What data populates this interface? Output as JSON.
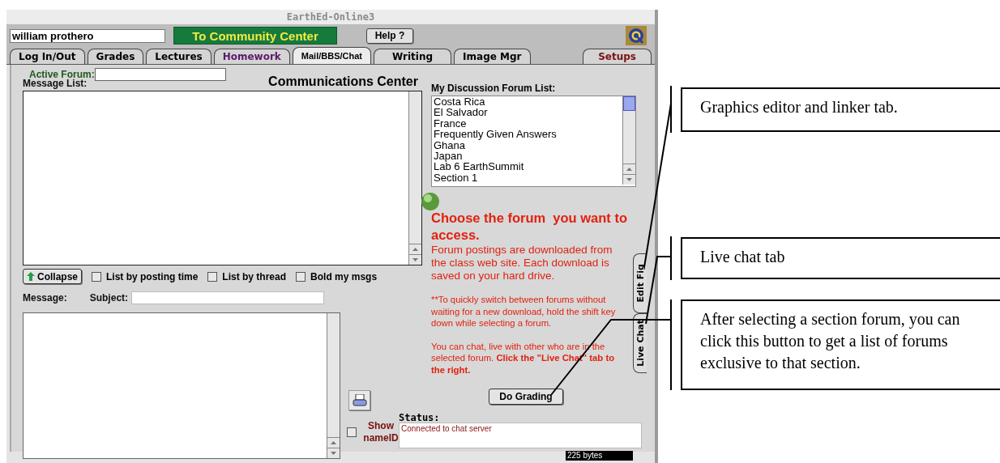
{
  "window": {
    "title": "EarthEd-Online3"
  },
  "user_field": {
    "value": "william prothero"
  },
  "community_button": "To Community Center",
  "help_button": "Help ?",
  "tabs": [
    {
      "label": "Log In/Out",
      "selected": false,
      "color": "#000000"
    },
    {
      "label": "Grades",
      "selected": false,
      "color": "#000000"
    },
    {
      "label": "Lectures",
      "selected": false,
      "color": "#000000"
    },
    {
      "label": "Homework",
      "selected": false,
      "color": "#5a1a6a"
    },
    {
      "label": "Mail/BBS/Chat",
      "selected": true,
      "color": "#000000"
    },
    {
      "label": "Writing",
      "selected": false,
      "color": "#000000"
    },
    {
      "label": "Image Mgr",
      "selected": false,
      "color": "#000000"
    },
    {
      "label": "Setups",
      "selected": false,
      "color": "#7a1010"
    }
  ],
  "active_forum": {
    "label": "Active Forum:"
  },
  "heading": "Communications Center",
  "message_list": {
    "label": "Message List:"
  },
  "collapse_button": "Collapse",
  "options": [
    {
      "label": "List by posting time",
      "checked": false
    },
    {
      "label": "List by thread",
      "checked": false
    },
    {
      "label": "Bold my msgs",
      "checked": false
    }
  ],
  "message_label": "Message:",
  "subject": {
    "label": "Subject:"
  },
  "forum_list": {
    "label": "My Discussion Forum List:",
    "items": [
      "Costa Rica",
      "El Salvador",
      "France",
      "Frequently Given Answers",
      "Ghana",
      "Japan",
      "Lab 6 EarthSummit",
      "Section 1"
    ]
  },
  "instructions": {
    "title": "Choose the forum  you want to access.",
    "body": "Forum postings are downloaded from the class web site. Each download is saved on your hard drive.",
    "tip": "**To quickly switch between forums without waiting for a new download, hold the shift key down while selecting a forum.",
    "chat_note": "You can chat, live with other who are in the selected forum. **Click the \"Live Chat\" tab to the right.**"
  },
  "grading_button": "Do Grading",
  "show_name_id": {
    "label": "Show nameID",
    "checked": false
  },
  "status": {
    "label": "Status:",
    "text": "Connected to chat server",
    "size": "225 bytes"
  },
  "side_tabs": [
    {
      "label": "Edit Fig"
    },
    {
      "label": "Live Chat"
    }
  ],
  "callouts": [
    "Graphics editor and linker tab.",
    "Live chat tab",
    "After selecting a section forum, you can click this button to get a list of forums exclusive to that section."
  ]
}
